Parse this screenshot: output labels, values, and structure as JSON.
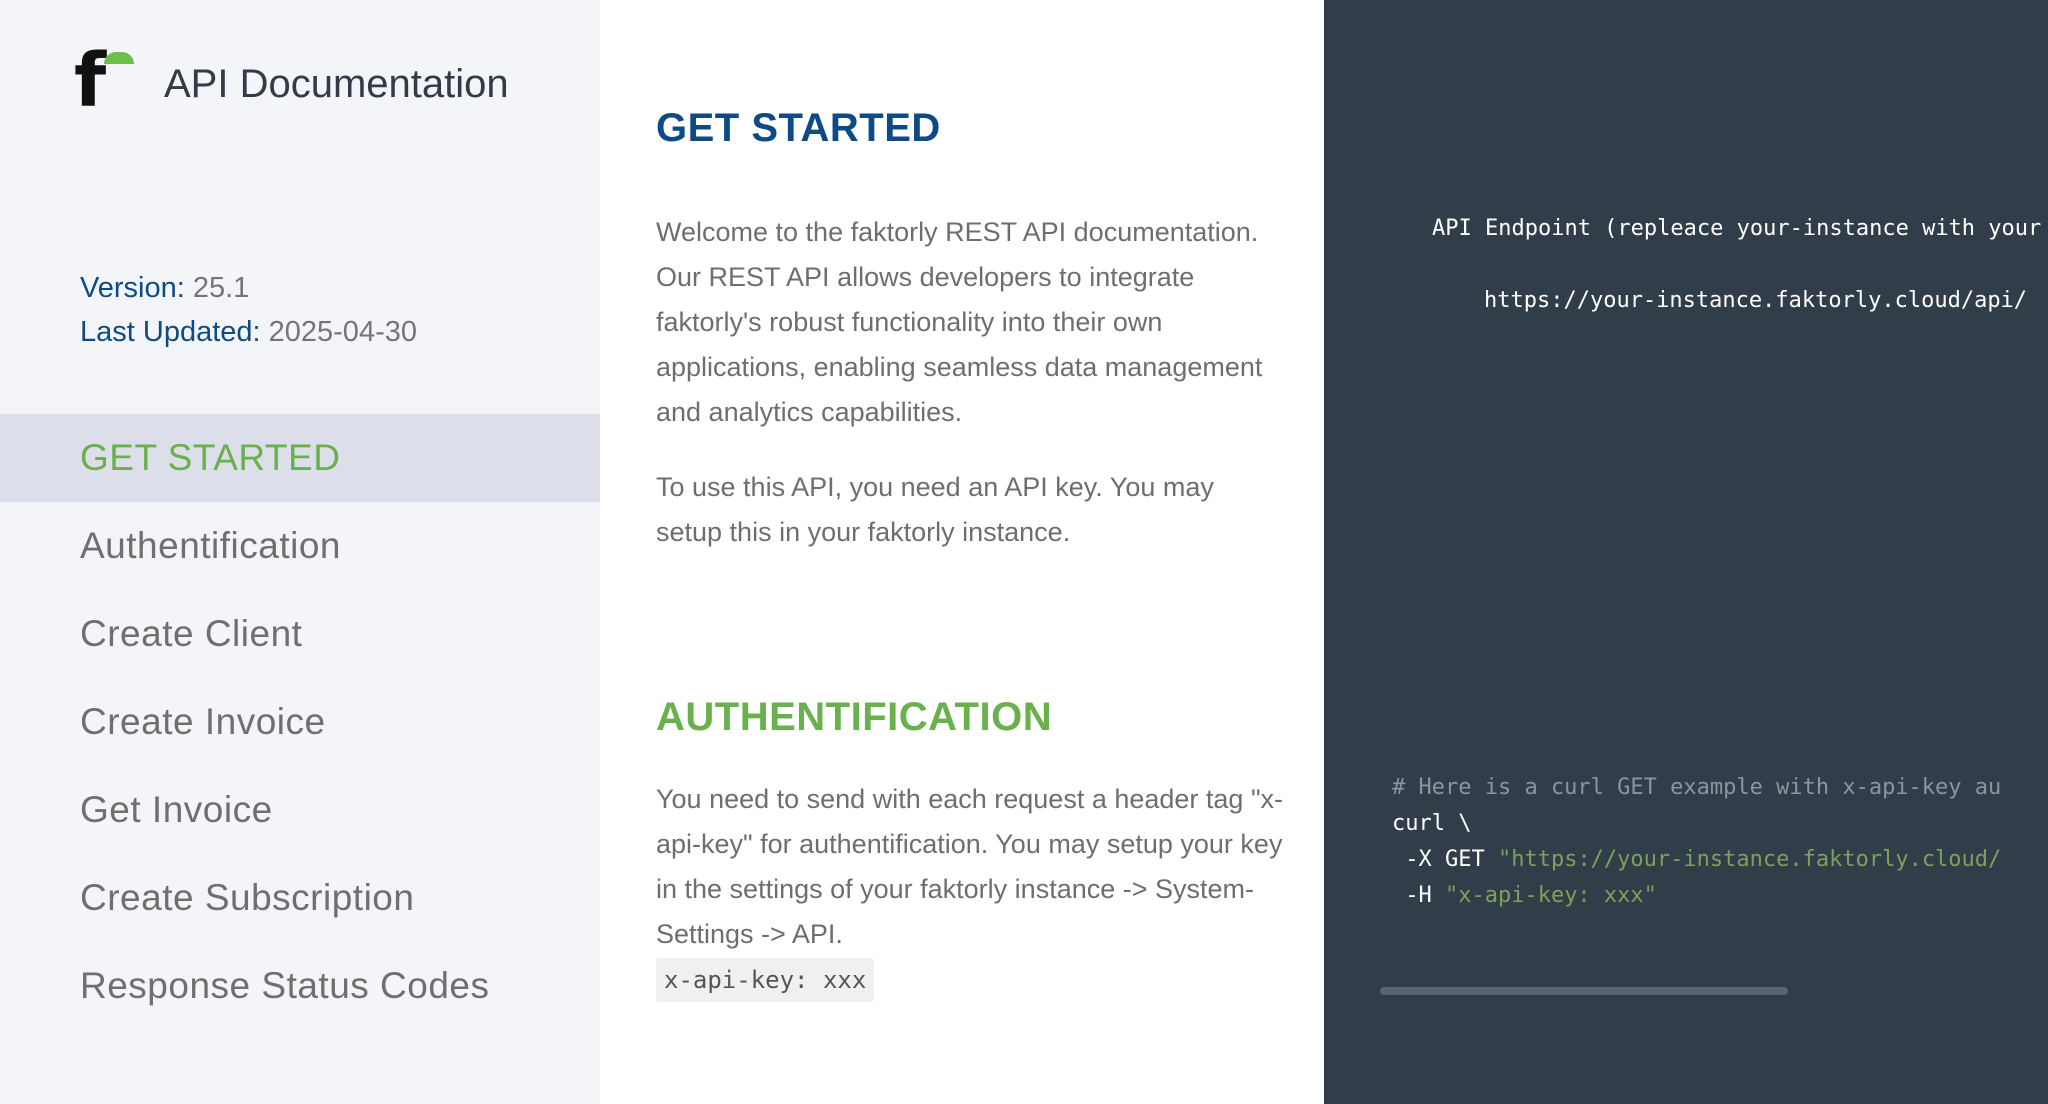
{
  "brand": {
    "title": "API Documentation",
    "logo_letter": "f",
    "logo_color": "#6cc04a"
  },
  "meta": {
    "version_label": "Version:",
    "version_value": "25.1",
    "updated_label": "Last Updated:",
    "updated_value": "2025-04-30"
  },
  "nav": {
    "items": [
      {
        "label": "GET STARTED"
      },
      {
        "label": "Authentification"
      },
      {
        "label": "Create Client"
      },
      {
        "label": "Create Invoice"
      },
      {
        "label": "Get Invoice"
      },
      {
        "label": "Create Subscription"
      },
      {
        "label": "Response Status Codes"
      }
    ],
    "active_index": 0
  },
  "content": {
    "get_started": {
      "heading": "GET STARTED",
      "p1": "Welcome to the faktorly REST API documentation. Our REST API allows developers to integrate faktorly's robust functionality into their own applications, enabling seamless data management and analytics capabilities.",
      "p2": "To use this API, you need an API key. You may setup this in your faktorly instance."
    },
    "auth": {
      "heading": "AUTHENTIFICATION",
      "p1": "You need to send with each request a header tag \"x-api-key\" for authentification. You may setup your key in the settings of your faktorly instance -> System-Settings -> API.",
      "code": "x-api-key: xxx"
    }
  },
  "code_panel": {
    "endpoint_label": "API Endpoint (repleace your-instance with your",
    "endpoint_url": "https://your-instance.faktorly.cloud/api/",
    "comment": "# Here is a curl GET example with x-api-key au",
    "line1": "curl \\",
    "line2_flag": " -X GET ",
    "line2_str": "\"https://your-instance.faktorly.cloud/",
    "line3_flag": " -H ",
    "line3_str": "\"x-api-key: xxx\""
  }
}
